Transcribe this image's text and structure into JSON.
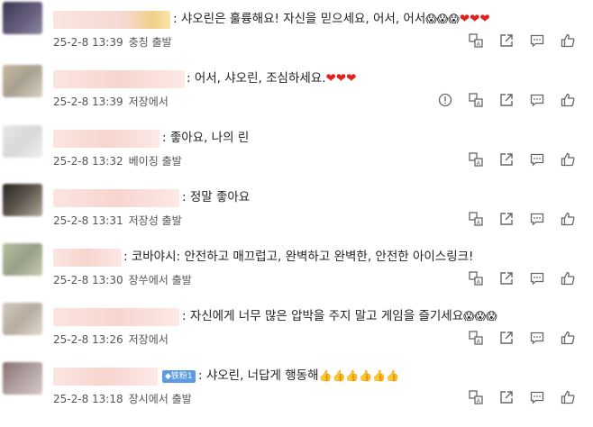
{
  "comments": [
    {
      "text": ": 샤오린은 훌륭해요! 자신을 믿으세요, 어서, 어서",
      "emoji": "😱😱😱",
      "hearts": "❤❤❤",
      "time": "25-2-8 13:39",
      "place": "충칭 출발",
      "badge": ""
    },
    {
      "text": ": 어서, 샤오린, 조심하세요.",
      "emoji": "",
      "hearts": "❤❤❤",
      "time": "25-2-8 13:39",
      "place": "저장에서",
      "badge": ""
    },
    {
      "text": ": 좋아요, 나의 린",
      "emoji": "",
      "hearts": "",
      "time": "25-2-8 13:32",
      "place": "베이징 출발",
      "badge": ""
    },
    {
      "text": ": 정말 좋아요",
      "emoji": "",
      "hearts": "",
      "time": "25-2-8 13:31",
      "place": "저장성 출발",
      "badge": ""
    },
    {
      "text": ": 코바야시: 안전하고 매끄럽고, 완벽하고 완벽한, 안전한 아이스링크!",
      "emoji": "",
      "hearts": "",
      "time": "25-2-8 13:30",
      "place": "장쑤에서 출발",
      "badge": ""
    },
    {
      "text": ": 자신에게 너무 많은 압박을 주지 말고 게임을 즐기세요",
      "emoji": "😱😱😱",
      "hearts": "",
      "time": "25-2-8 13:26",
      "place": "저장에서",
      "badge": ""
    },
    {
      "text": ": 샤오린, 너답게 행동해",
      "emoji": "👍👍👍👍👍👍",
      "hearts": "",
      "time": "25-2-8 13:18",
      "place": "장시에서 출발",
      "badge": "◆铁粉1"
    }
  ],
  "icons": [
    "report-icon",
    "translate-icon",
    "share-icon",
    "comment-icon",
    "like-icon"
  ]
}
